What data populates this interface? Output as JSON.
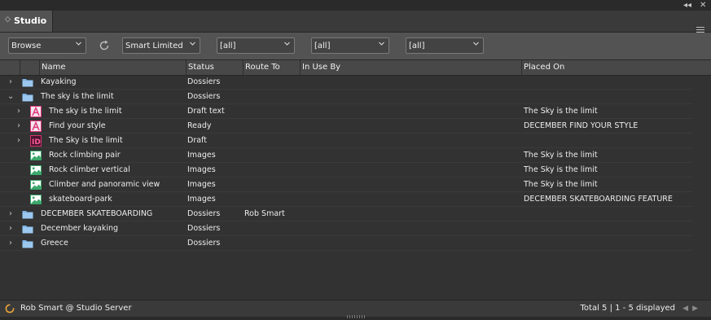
{
  "window": {
    "collapse_glyph": "◂◂",
    "close_glyph": "✕"
  },
  "tab": {
    "title": "Studio",
    "chevron": "◇"
  },
  "toolbar": {
    "browse": "Browse",
    "query": "Smart Limited",
    "filter1": "[all]",
    "filter2": "[all]",
    "filter3": "[all]"
  },
  "columns": {
    "name": "Name",
    "status": "Status",
    "route_to": "Route To",
    "in_use_by": "In Use By",
    "placed_on": "Placed On"
  },
  "rows": [
    {
      "indent": 0,
      "expander": "›",
      "icon": "folder-icon",
      "name": "Kayaking",
      "status": "Dossiers",
      "route_to": "",
      "in_use_by": "",
      "placed_on": ""
    },
    {
      "indent": 0,
      "expander": "⌄",
      "icon": "folder-icon",
      "name": "The sky is the limit",
      "status": "Dossiers",
      "route_to": "",
      "in_use_by": "",
      "placed_on": ""
    },
    {
      "indent": 1,
      "expander": "›",
      "icon": "incopy-icon",
      "name": "The sky is the limit",
      "status": "Draft text",
      "route_to": "",
      "in_use_by": "",
      "placed_on": "The Sky is the limit"
    },
    {
      "indent": 1,
      "expander": "›",
      "icon": "incopy-icon",
      "name": "Find your style",
      "status": "Ready",
      "route_to": "",
      "in_use_by": "",
      "placed_on": "DECEMBER FIND YOUR STYLE"
    },
    {
      "indent": 1,
      "expander": "›",
      "icon": "indesign-icon",
      "name": "The Sky is the limit",
      "status": "Draft",
      "route_to": "",
      "in_use_by": "",
      "placed_on": ""
    },
    {
      "indent": 1,
      "expander": "",
      "icon": "image-icon",
      "name": "Rock climbing pair",
      "status": "Images",
      "route_to": "",
      "in_use_by": "",
      "placed_on": "The Sky is the limit"
    },
    {
      "indent": 1,
      "expander": "",
      "icon": "image-icon",
      "name": "Rock climber vertical",
      "status": "Images",
      "route_to": "",
      "in_use_by": "",
      "placed_on": "The Sky is the limit"
    },
    {
      "indent": 1,
      "expander": "",
      "icon": "image-icon",
      "name": "Climber and panoramic view",
      "status": "Images",
      "route_to": "",
      "in_use_by": "",
      "placed_on": "The Sky is the limit"
    },
    {
      "indent": 1,
      "expander": "",
      "icon": "image-icon",
      "name": "skateboard-park",
      "status": "Images",
      "route_to": "",
      "in_use_by": "",
      "placed_on": "DECEMBER SKATEBOARDING FEATURE"
    },
    {
      "indent": 0,
      "expander": "›",
      "icon": "folder-icon",
      "name": "DECEMBER SKATEBOARDING",
      "status": "Dossiers",
      "route_to": "Rob Smart",
      "in_use_by": "",
      "placed_on": ""
    },
    {
      "indent": 0,
      "expander": "›",
      "icon": "folder-icon",
      "name": "December kayaking",
      "status": "Dossiers",
      "route_to": "",
      "in_use_by": "",
      "placed_on": ""
    },
    {
      "indent": 0,
      "expander": "›",
      "icon": "folder-icon",
      "name": "Greece",
      "status": "Dossiers",
      "route_to": "",
      "in_use_by": "",
      "placed_on": ""
    }
  ],
  "statusbar": {
    "user": "Rob Smart @ Studio Server",
    "total": "Total 5 | 1 - 5 displayed",
    "prev": "◀",
    "next": "▶"
  },
  "colors": {
    "accent_orange": "#e8a33a",
    "folder_blue": "#7eb3e6",
    "incopy_pink": "#e0357a",
    "indesign_pink": "#d6336b",
    "image_green": "#3aa86a"
  }
}
